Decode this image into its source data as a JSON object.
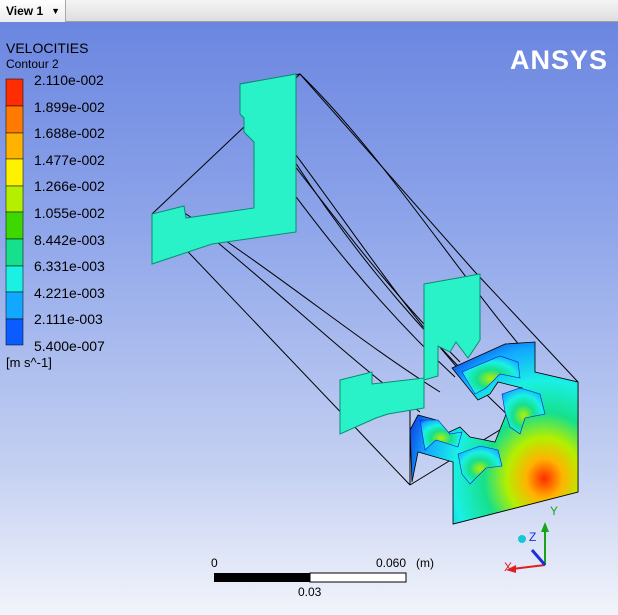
{
  "view_tab": {
    "label": "View 1",
    "caret_icon": "chevron-down-icon"
  },
  "legend": {
    "title": "VELOCITIES",
    "subtitle": "Contour 2",
    "unit": "[m s^-1]",
    "levels": [
      "2.110e-002",
      "1.899e-002",
      "1.688e-002",
      "1.477e-002",
      "1.266e-002",
      "1.055e-002",
      "8.442e-003",
      "6.331e-003",
      "4.221e-003",
      "2.111e-003",
      "5.400e-007"
    ],
    "colors": [
      "#ff2d00",
      "#ff7a00",
      "#ffb300",
      "#fff200",
      "#b4ef00",
      "#3ed800",
      "#16e08c",
      "#1af0e4",
      "#12a8ff",
      "#0b5cff",
      "#0b1ed8"
    ]
  },
  "logo": {
    "text": "ANSYS"
  },
  "scale_bar": {
    "start_label": "0",
    "end_label": "0.060",
    "unit": "(m)",
    "mid_label": "0.03"
  },
  "triad": {
    "x_label": "X",
    "y_label": "Y",
    "z_label": "Z"
  }
}
